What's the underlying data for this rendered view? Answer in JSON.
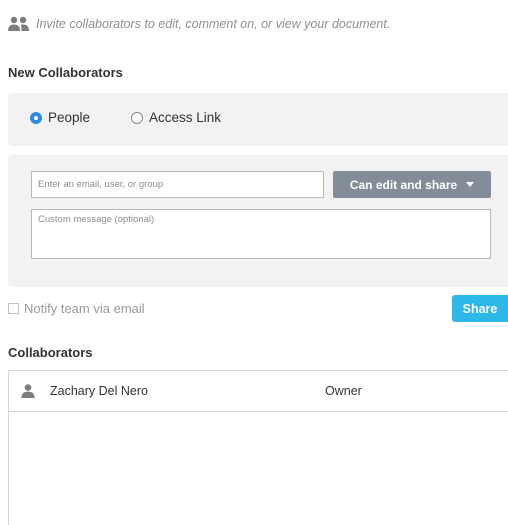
{
  "invite": {
    "icon": "people-icon",
    "text": "Invite collaborators to edit, comment on, or view your document."
  },
  "new_collaborators": {
    "title": "New Collaborators",
    "modes": [
      {
        "label": "People",
        "selected": true
      },
      {
        "label": "Access Link",
        "selected": false
      }
    ],
    "email_placeholder": "Enter an email, user, or group",
    "email_value": "",
    "permission_label": "Can edit and share",
    "permission_icon": "caret-down-icon",
    "message_placeholder": "Custom message (optional)",
    "message_value": ""
  },
  "notify": {
    "label": "Notify team via email",
    "checked": false
  },
  "share_button": {
    "label": "Share"
  },
  "collaborators": {
    "title": "Collaborators",
    "rows": [
      {
        "icon": "user-icon",
        "name": "Zachary Del Nero",
        "role": "Owner"
      }
    ]
  },
  "colors": {
    "accent_blue": "#2d8ae3",
    "share_button": "#2db8e8",
    "dropdown_gray": "#838d99",
    "panel_gray": "#f2f2f2"
  }
}
